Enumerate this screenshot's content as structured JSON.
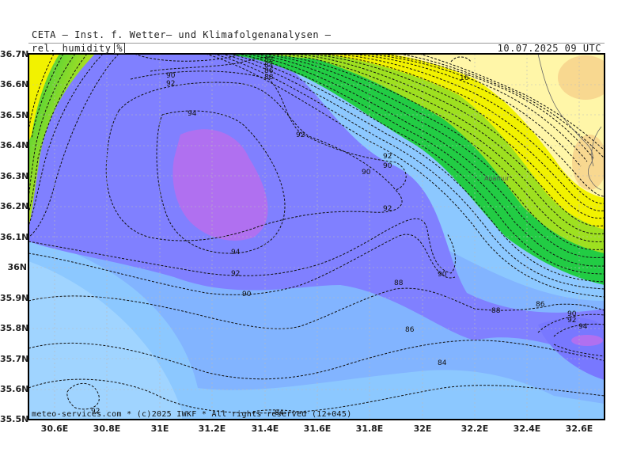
{
  "header": {
    "title": "CETA — Inst. f. Wetter— und Klimafolgenanalysen —",
    "parameter": "rel. humidity",
    "unit": "%",
    "datetime": "10.07.2025 09 UTC"
  },
  "axes": {
    "lat_labels": [
      "36.7N",
      "36.6N",
      "36.5N",
      "36.4N",
      "36.3N",
      "36.2N",
      "36.1N",
      "36N",
      "35.9N",
      "35.8N",
      "35.7N",
      "35.6N",
      "35.5N"
    ],
    "lon_labels": [
      "30.6E",
      "30.8E",
      "31E",
      "31.2E",
      "31.4E",
      "31.6E",
      "31.8E",
      "32E",
      "32.2E",
      "32.4E",
      "32.6E"
    ]
  },
  "footer": {
    "credit": "meteo-services.com * (c)2025 IWKF * All rights reserved (12+045)"
  },
  "place_label": "Anamur",
  "contour_labels": [
    "16",
    "90",
    "92",
    "94",
    "92",
    "90",
    "92",
    "90",
    "92",
    "94",
    "92",
    "90",
    "88",
    "90",
    "88",
    "86",
    "90",
    "92",
    "94",
    "86",
    "84",
    "92",
    "84"
  ],
  "colors": {
    "deep_violet": "#b070f0",
    "violet_blue": "#8080ff",
    "blue": "#82b4ff",
    "light_blue": "#8cc8ff",
    "green": "#22cc22",
    "yellow": "#f2f200",
    "pale_yellow": "#fff6a8",
    "tan": "#f8d890"
  }
}
